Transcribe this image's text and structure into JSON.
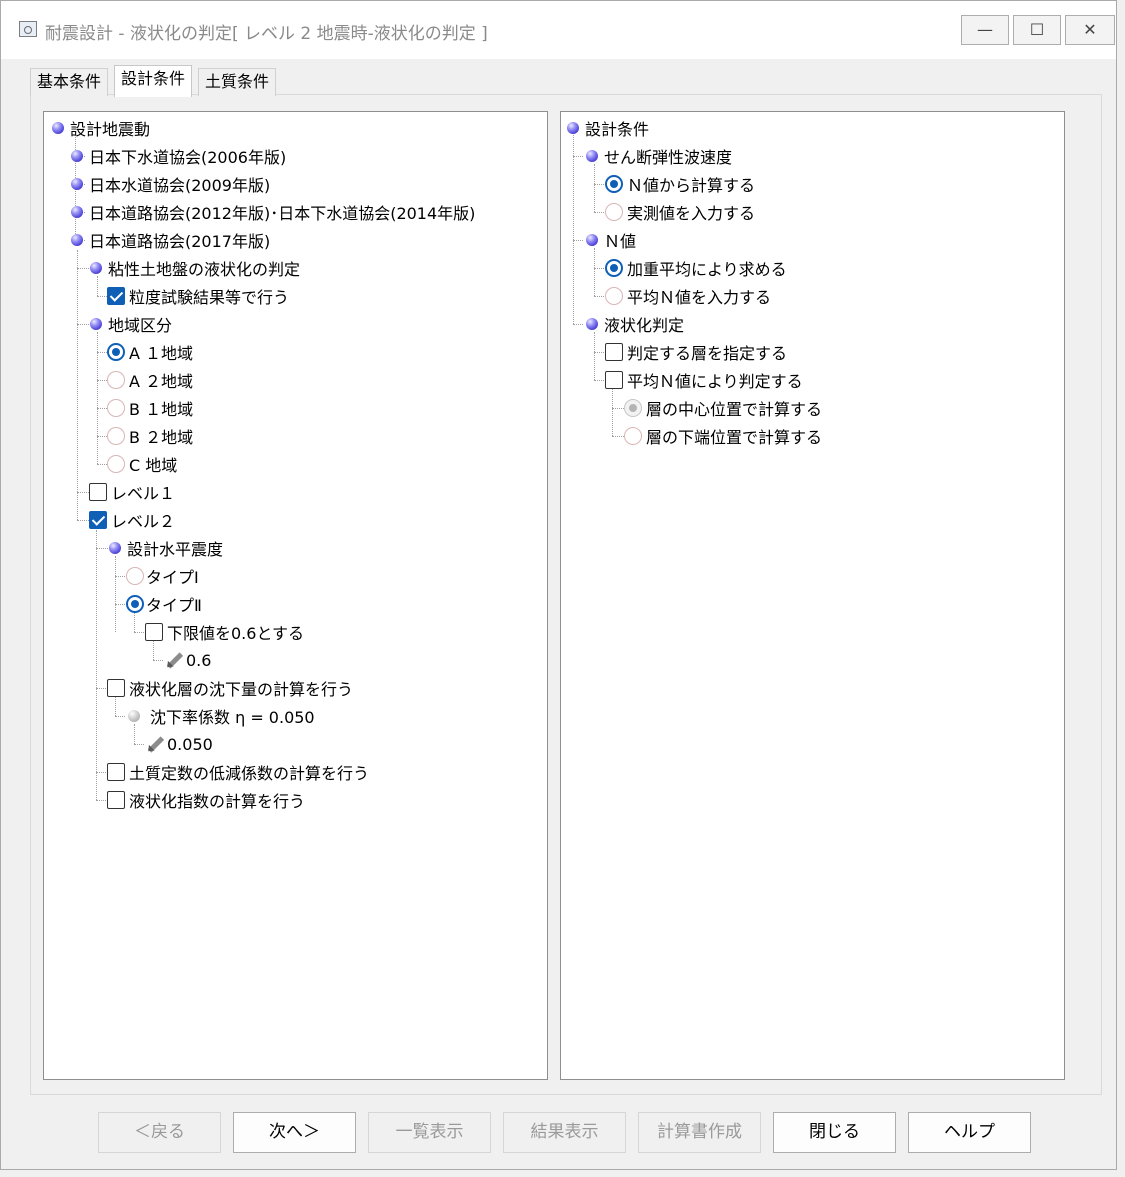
{
  "window": {
    "title": "耐震設計 - 液状化の判定[ レベル 2 地震時-液状化の判定 ]",
    "controls": {
      "minimize": "—",
      "maximize": "☐",
      "close": "✕"
    }
  },
  "tabs": [
    "基本条件",
    "設計条件",
    "土質条件"
  ],
  "left_tree": {
    "root": "設計地震動",
    "std2006": "日本下水道協会(2006年版)",
    "std2009": "日本水道協会(2009年版)",
    "std2012": "日本道路協会(2012年版)･日本下水道協会(2014年版)",
    "std2017": "日本道路協会(2017年版)",
    "clay": "粘性土地盤の液状化の判定",
    "grain": "粒度試験結果等で行う",
    "region": "地域区分",
    "a1": "A １地域",
    "a2": "A ２地域",
    "b1": "B １地域",
    "b2": "B ２地域",
    "c": "C 地域",
    "level1": "レベル１",
    "level2": "レベル２",
    "seismic": "設計水平震度",
    "type1": "タイプⅠ",
    "type2": "タイプⅡ",
    "lower_limit": "下限値を0.6とする",
    "lower_value": "0.6",
    "settlement": "液状化層の沈下量の計算を行う",
    "eta": "沈下率係数 η = 0.050",
    "eta_value": "0.050",
    "reduction": "土質定数の低減係数の計算を行う",
    "index": "液状化指数の計算を行う"
  },
  "right_tree": {
    "root": "設計条件",
    "shear": "せん断弾性波速度",
    "from_n": "Ｎ値から計算する",
    "measured": "実測値を入力する",
    "n_value": "Ｎ値",
    "weighted": "加重平均により求める",
    "avg_input": "平均Ｎ値を入力する",
    "liq": "液状化判定",
    "layer_spec": "判定する層を指定する",
    "avg_judge": "平均Ｎ値により判定する",
    "center": "層の中心位置で計算する",
    "bottom": "層の下端位置で計算する"
  },
  "buttons": {
    "back": "＜戻る",
    "next": "次へ＞",
    "list": "一覧表示",
    "result": "結果表示",
    "report": "計算書作成",
    "close": "閉じる",
    "help": "ヘルプ"
  }
}
